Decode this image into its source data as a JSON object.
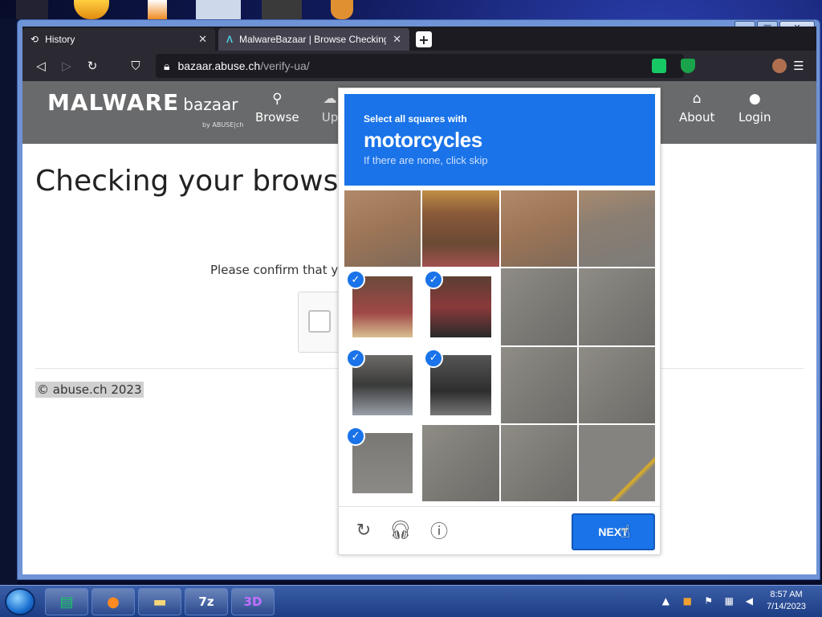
{
  "browser": {
    "tabs": [
      {
        "title": "History",
        "active": false
      },
      {
        "title": "MalwareBazaar | Browse Checking",
        "active": true
      }
    ],
    "url_host": "bazaar.abuse.ch",
    "url_path": "/verify-ua/"
  },
  "site": {
    "logo_main": "MALWARE",
    "logo_sub": "bazaar",
    "logo_by": "by ABUSE|ch",
    "menu": [
      {
        "label": "Browse",
        "icon": "search-icon"
      },
      {
        "label": "Up",
        "icon": "upload-cloud-icon"
      },
      {
        "label": "About",
        "icon": "building-icon"
      },
      {
        "label": "Login",
        "icon": "user-icon"
      }
    ],
    "heading": "Checking your brows",
    "confirm_text": "Please confirm that you",
    "footer": "© abuse.ch 2023"
  },
  "captcha": {
    "instruction_line1": "Select all squares with",
    "target": "motorcycles",
    "instruction_line3": "If there are none, click skip",
    "next_label": "NEXT",
    "selected_tiles": [
      4,
      5,
      8,
      9,
      12
    ]
  },
  "taskbar": {
    "time": "8:57 AM",
    "date": "7/14/2023"
  },
  "colors": {
    "captcha_blue": "#1a73e8",
    "header_gray": "#696a6c"
  }
}
